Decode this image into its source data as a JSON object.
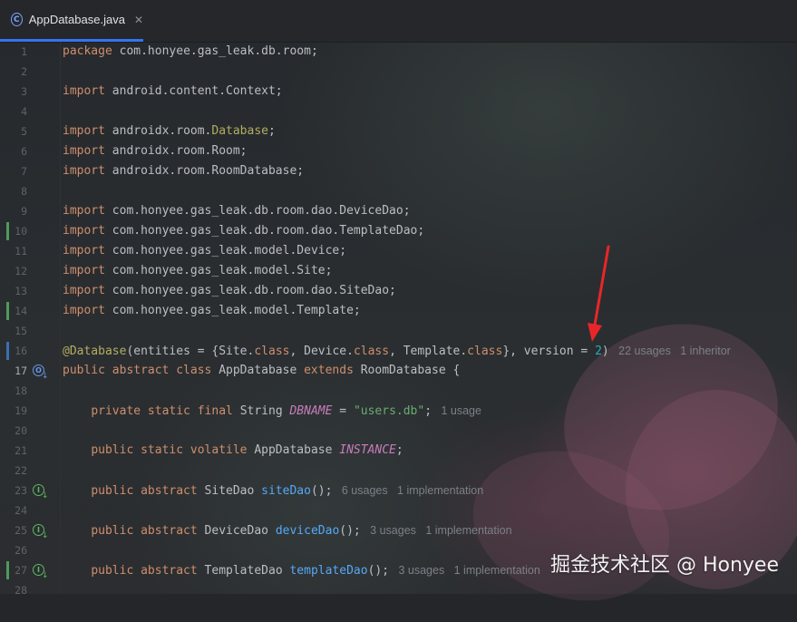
{
  "tab": {
    "label": "AppDatabase.java",
    "close": "✕",
    "icon": "java-class-icon"
  },
  "code_lines": [
    {
      "num": "1",
      "segments": [
        [
          "k",
          "package "
        ],
        [
          "p",
          "com.honyee.gas_leak.db.room;"
        ]
      ]
    },
    {
      "num": "2",
      "segments": []
    },
    {
      "num": "3",
      "segments": [
        [
          "k",
          "import "
        ],
        [
          "p",
          "android.content.Context;"
        ]
      ]
    },
    {
      "num": "4",
      "segments": []
    },
    {
      "num": "5",
      "segments": [
        [
          "k",
          "import "
        ],
        [
          "p",
          "androidx.room."
        ],
        [
          "a",
          "Database"
        ],
        [
          "p",
          ";"
        ]
      ]
    },
    {
      "num": "6",
      "segments": [
        [
          "k",
          "import "
        ],
        [
          "p",
          "androidx.room.Room;"
        ]
      ]
    },
    {
      "num": "7",
      "segments": [
        [
          "k",
          "import "
        ],
        [
          "p",
          "androidx.room.RoomDatabase;"
        ]
      ]
    },
    {
      "num": "8",
      "segments": []
    },
    {
      "num": "9",
      "segments": [
        [
          "k",
          "import "
        ],
        [
          "p",
          "com.honyee.gas_leak.db.room.dao.DeviceDao;"
        ]
      ]
    },
    {
      "num": "10",
      "segments": [
        [
          "k",
          "import "
        ],
        [
          "p",
          "com.honyee.gas_leak.db.room.dao.TemplateDao;"
        ]
      ],
      "gutter": "green"
    },
    {
      "num": "11",
      "segments": [
        [
          "k",
          "import "
        ],
        [
          "p",
          "com.honyee.gas_leak.model.Device;"
        ]
      ]
    },
    {
      "num": "12",
      "segments": [
        [
          "k",
          "import "
        ],
        [
          "p",
          "com.honyee.gas_leak.model.Site;"
        ]
      ]
    },
    {
      "num": "13",
      "segments": [
        [
          "k",
          "import "
        ],
        [
          "p",
          "com.honyee.gas_leak.db.room.dao.SiteDao;"
        ]
      ]
    },
    {
      "num": "14",
      "segments": [
        [
          "k",
          "import "
        ],
        [
          "p",
          "com.honyee.gas_leak.model.Template;"
        ]
      ],
      "gutter": "green"
    },
    {
      "num": "15",
      "segments": []
    },
    {
      "num": "16",
      "segments": [
        [
          "a",
          "@Database"
        ],
        [
          "p",
          "(entities = {Site."
        ],
        [
          "k",
          "class"
        ],
        [
          "p",
          ", Device."
        ],
        [
          "k",
          "class"
        ],
        [
          "p",
          ", Template."
        ],
        [
          "k",
          "class"
        ],
        [
          "p",
          "}, version = "
        ],
        [
          "n",
          "2"
        ],
        [
          "p",
          ")"
        ]
      ],
      "hint": "22 usages   1 inheritor",
      "gutter": "blue"
    },
    {
      "num": "17",
      "segments": [
        [
          "k",
          "public abstract class "
        ],
        [
          "p",
          "AppDatabase "
        ],
        [
          "k",
          "extends "
        ],
        [
          "p",
          "RoomDatabase {"
        ]
      ],
      "active": true,
      "icon": "blue"
    },
    {
      "num": "18",
      "segments": []
    },
    {
      "num": "19",
      "segments": [
        [
          "p",
          "    "
        ],
        [
          "k",
          "private static final "
        ],
        [
          "p",
          "String "
        ],
        [
          "c",
          "DBNAME"
        ],
        [
          "p",
          " = "
        ],
        [
          "s",
          "\"users.db\""
        ],
        [
          "p",
          ";"
        ]
      ],
      "hint": "1 usage"
    },
    {
      "num": "20",
      "segments": []
    },
    {
      "num": "21",
      "segments": [
        [
          "p",
          "    "
        ],
        [
          "k",
          "public static volatile "
        ],
        [
          "p",
          "AppDatabase "
        ],
        [
          "c",
          "INSTANCE"
        ],
        [
          "p",
          ";"
        ]
      ]
    },
    {
      "num": "22",
      "segments": []
    },
    {
      "num": "23",
      "segments": [
        [
          "p",
          "    "
        ],
        [
          "k",
          "public abstract "
        ],
        [
          "p",
          "SiteDao "
        ],
        [
          "f",
          "siteDao"
        ],
        [
          "p",
          "();"
        ]
      ],
      "hint": "6 usages   1 implementation",
      "icon": "green"
    },
    {
      "num": "24",
      "segments": []
    },
    {
      "num": "25",
      "segments": [
        [
          "p",
          "    "
        ],
        [
          "k",
          "public abstract "
        ],
        [
          "p",
          "DeviceDao "
        ],
        [
          "f",
          "deviceDao"
        ],
        [
          "p",
          "();"
        ]
      ],
      "hint": "3 usages   1 implementation",
      "icon": "green"
    },
    {
      "num": "26",
      "segments": []
    },
    {
      "num": "27",
      "segments": [
        [
          "p",
          "    "
        ],
        [
          "k",
          "public abstract "
        ],
        [
          "p",
          "TemplateDao "
        ],
        [
          "f",
          "templateDao"
        ],
        [
          "p",
          "();"
        ]
      ],
      "hint": "3 usages   1 implementation",
      "icon": "green",
      "gutter": "green"
    },
    {
      "num": "28",
      "segments": []
    }
  ],
  "annotation": {
    "type": "red-arrow",
    "color": "#e8262a",
    "points_to": "version = 2"
  },
  "watermark": "掘金技术社区 @ Honyee"
}
